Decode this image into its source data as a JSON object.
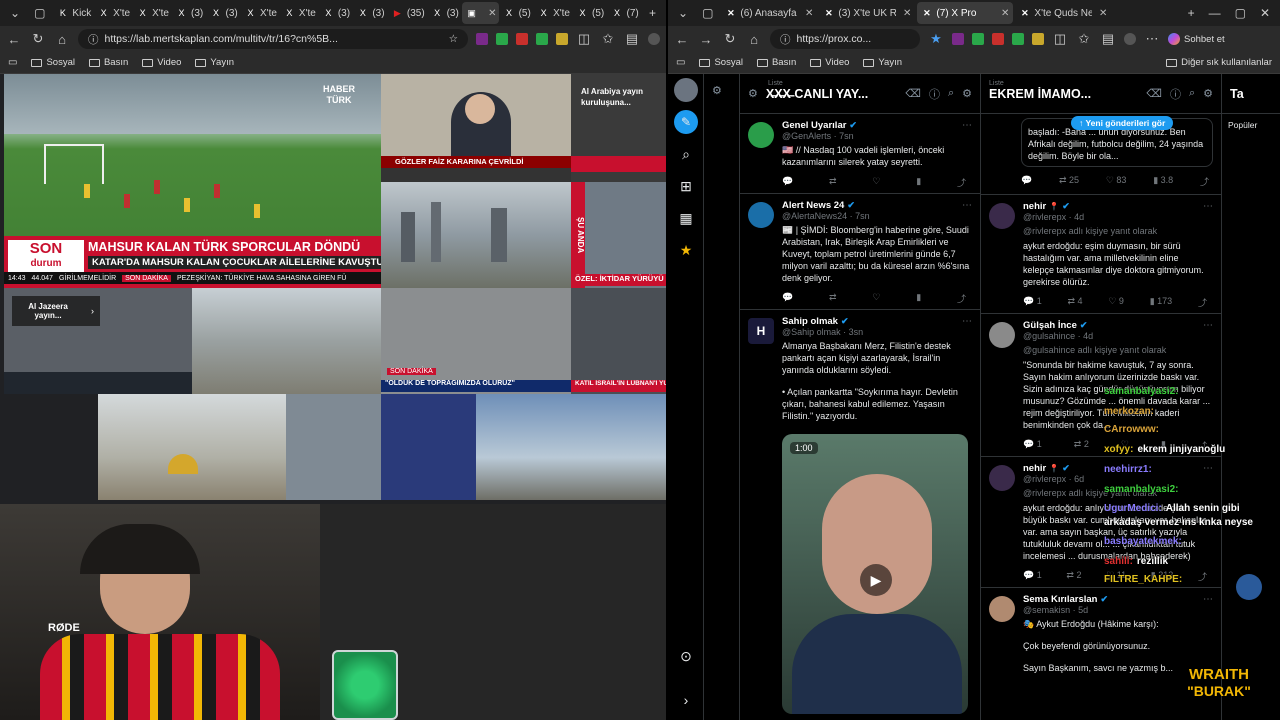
{
  "left_browser": {
    "tabs": [
      {
        "icon": "K",
        "label": "Kick"
      },
      {
        "icon": "X",
        "label": "X'te"
      },
      {
        "icon": "X",
        "label": "X'te"
      },
      {
        "icon": "X",
        "label": "(3)"
      },
      {
        "icon": "X",
        "label": "(3)"
      },
      {
        "icon": "X",
        "label": "X'te"
      },
      {
        "icon": "X",
        "label": "X'te"
      },
      {
        "icon": "X",
        "label": "(3)"
      },
      {
        "icon": "X",
        "label": "(3)"
      },
      {
        "icon": "▶",
        "label": "(35)"
      },
      {
        "icon": "X",
        "label": "(3)"
      },
      {
        "icon": "▣",
        "label": ""
      },
      {
        "icon": "X",
        "label": "(5)"
      },
      {
        "icon": "X",
        "label": "X'te"
      },
      {
        "icon": "X",
        "label": "(5)"
      },
      {
        "icon": "X",
        "label": "(7)"
      }
    ],
    "url": "https://lab.mertskaplan.com/multitv/tr/16?cn%5B...",
    "bookmarks": [
      "Sosyal",
      "Basın",
      "Video",
      "Yayın"
    ]
  },
  "tv": {
    "haberturk": "HABER TÜRK",
    "son_durum_top": "SON",
    "son_durum_bottom": "durum",
    "headline": "MAHSUR KALAN TÜRK SPORCULAR DÖNDÜ",
    "subheadline": "KATAR'DA MAHSUR KALAN ÇOCUKLAR AİLELERİNE KAVUŞTU",
    "ticker_time": "14:43",
    "ticker_value": "44.047",
    "ticker_son_dakika": "SON DAKİKA",
    "ticker_a": "GİRİLMEMELİDİR",
    "ticker_b": "PEZEŞKİYAN: TÜRKİYE HAVA SAHASINA GİREN FÜ",
    "faiz": "GÖZLER FAİZ KARARINA ÇEVRİLDİ",
    "al_arabiya": "Al Arabiya yayın kuruluşuna...",
    "su_anda": "ŞU ANDA",
    "ozel": "ÖZEL: İKTİDAR YÜRÜYÜ",
    "al_jazeera": "Al Jazeera yayın...",
    "son_dakika_small": "SON DAKİKA",
    "olduk": "\"ÖLDÜK DE TOPRAĞIMIZDA ÖLÜRÜZ\"",
    "katil": "KATİL İSRAİL'İN LÜBNAN'I YUV"
  },
  "right_browser": {
    "tabs": [
      {
        "label": "(6) Anasayfa / X"
      },
      {
        "label": "(3) X'te UK Reporte"
      },
      {
        "label": "(7) X Pro"
      },
      {
        "label": "X'te Quds News Ne"
      }
    ],
    "url": "https://prox.co...",
    "profile_label": "Sohbet et",
    "bookmarks": [
      "Sosyal",
      "Basın",
      "Video",
      "Yayın"
    ],
    "other_bookmarks": "Diğer sık kullanılanlar"
  },
  "xpro": {
    "col1": {
      "liste": "Liste",
      "title": "X̶X̶X̶ CANLI YAY...",
      "tweets": [
        {
          "name": "Genel Uyarılar",
          "handle": "@GenAlerts · 7sn",
          "text": "🇺🇸 // Nasdaq 100 vadeli işlemleri, önceki kazanımlarını silerek yatay seyretti.",
          "replies": "",
          "retweets": "",
          "likes": "",
          "views": ""
        },
        {
          "name": "Alert News 24",
          "handle": "@AlertaNews24 · 7sn",
          "text": "📰 | ŞİMDİ: Bloomberg'in haberine göre, Suudi Arabistan, Irak, Birleşik Arap Emirlikleri ve Kuveyt, toplam petrol üretimlerini günde 6,7 milyon varil azalttı; bu da küresel arzın %6'sına denk geliyor.",
          "replies": "",
          "retweets": "",
          "likes": "",
          "views": ""
        },
        {
          "name": "Sahip olmak",
          "handle": "@Sahip olmak · 3sn",
          "text": "Almanya Başbakanı Merz, Filistin'e destek pankartı açan kişiyi azarlayarak, İsrail'in yanında olduklarını söyledi.",
          "text2": "• Açılan pankartta \"Soykırıma hayır. Devletin çıkarı, bahanesi kabul edilemez. Yaşasın Filistin.\" yazıyordu.",
          "video_time": "1:00"
        }
      ]
    },
    "col2": {
      "liste": "Liste",
      "title": "EKREM İMAMO...",
      "new_posts": "Yeni gönderileri gör",
      "top_text": "başladı: -Bana ... unun diyorsunuz. Ben Afrikalı değilim, futbolcu değilim, 24 yaşında değilim. Böyle bir ola...",
      "top_actions": {
        "replies": "",
        "retweets": "25",
        "likes": "83",
        "views": "3.8"
      },
      "tweets": [
        {
          "name": "nehir",
          "handle": "@rivlerepx · 4d",
          "reply_to": "@rivlerepx adlı kişiye yanıt olarak",
          "text": "aykut erdoğdu: eşim duymasın, bir sürü hastalığım var. ama milletvekilinin eline kelepçe takmasınlar diye doktora gitmiyorum. gerekirse ölürüz.",
          "replies": "1",
          "retweets": "4",
          "likes": "9",
          "views": "173"
        },
        {
          "name": "Gülşah İnce",
          "handle": "@gulsahince · 4d",
          "reply_to": "@gulsahince adlı kişiye yanıt olarak",
          "text": "\"Sonunda bir hakime kavuştuk, 7 ay sonra. Sayın hakim anlıyorum üzerinizde baskı var. Sizin adınıza kaç gündür düşünüyorum biliyor musunuz? Gözümde ... önemli davada karar ... rejim değiştiriliyor. Türk Milletinin kaderi benimkinden çok da...",
          "replies": "1",
          "retweets": "2",
          "likes": "",
          "views": ""
        },
        {
          "name": "nehir",
          "handle": "@rivlerepx · 6d",
          "reply_to": "@rivlerepx adlı kişiye yanıt olarak",
          "text": "aykut erdoğdu: anlıyorum üzerinizde çok büyük baskı var. cumhurbaşkanı var. hakanlar var. ama sayın başkan, üç satırlık yazıyla tutukluluk devamı ol... ... çıkanıldıktan tutuk incelemesi ... durusmalardan bahsederek)",
          "replies": "1",
          "retweets": "2",
          "likes": "11",
          "views": "212"
        },
        {
          "name": "Sema Kırılarslan",
          "handle": "@semakisn · 5d",
          "text": "🎭 Aykut Erdoğdu (Hâkime karşı):",
          "text2": "Çok beyefendi görünüyorsunuz.",
          "text3": "Sayın Başkanım, savcı ne yazmış b..."
        }
      ]
    },
    "col3_title": "Ta",
    "col3_sub": "Popüler"
  },
  "stream_chat": [
    {
      "user": "samanbalyasi2:",
      "color": "#3ecf3e",
      "msg": ""
    },
    {
      "user": "merkozan:",
      "color": "#d9a33a",
      "msg": ""
    },
    {
      "user": "CArrowww:",
      "color": "#d9a33a",
      "msg": ""
    },
    {
      "user": "xofyy:",
      "color": "#e0c020",
      "msg": "ekrem jinjiyanoğlu"
    },
    {
      "user": "neehirrz1:",
      "color": "#8a7cff",
      "msg": ""
    },
    {
      "user": "samanbalyasi2:",
      "color": "#3ecf3e",
      "msg": ""
    },
    {
      "user": "UgurMedici:",
      "color": "#8a7cff",
      "msg": "Allah senin gibi arkadaş vermez ıns knka neyse"
    },
    {
      "user": "basbayatekmek:",
      "color": "#8a7cff",
      "msg": ""
    },
    {
      "user": "sahili:",
      "color": "#e03030",
      "msg": "rezillik"
    },
    {
      "user": "FILTRE_KAHPE:",
      "color": "#e0c020",
      "msg": ""
    }
  ],
  "overlay": {
    "brand_line1": "WRAITH",
    "brand_line2": "\"BURAK\"",
    "mic_brand": "RØDE"
  }
}
